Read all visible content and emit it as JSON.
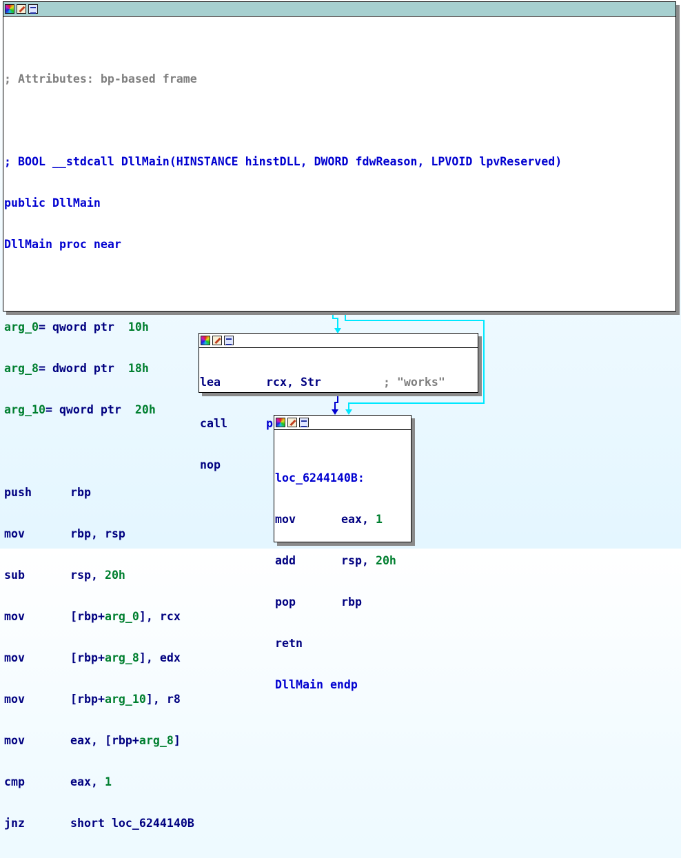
{
  "colors": {
    "keyword_blue": "#0000d0",
    "navy": "#000080",
    "number_green": "#007f2f",
    "comment_gray": "#7f7f7f",
    "main_titlebar": "#a7d0d0",
    "edge_cyan": "#00e8ff",
    "edge_blue": "#0000d0"
  },
  "titlebar_icons": [
    "graph-color-icon",
    "edit-node-icon",
    "text-view-icon"
  ],
  "main_block": {
    "comment": "; Attributes: bp-based frame",
    "prototype": "; BOOL __stdcall DllMain(HINSTANCE hinstDLL, DWORD fdwReason, LPVOID lpvReserved)",
    "public_kw": "public",
    "public_name": "DllMain",
    "proc_name": "DllMain",
    "proc_rest": "proc near",
    "args": [
      {
        "name": "arg_0",
        "eq": "=",
        "type": " qword ptr  ",
        "offset": "10h"
      },
      {
        "name": "arg_8",
        "eq": "=",
        "type": " dword ptr  ",
        "offset": "18h"
      },
      {
        "name": "arg_10",
        "eq": "=",
        "type": " qword ptr  ",
        "offset": "20h"
      }
    ],
    "ins": {
      "push": "push",
      "push_op": "rbp",
      "mov1": "mov",
      "mov1_op": "rbp, rsp",
      "sub": "sub",
      "sub_op1": "rsp, ",
      "sub_op2": "20h",
      "mov2": "mov",
      "mov2_a": "[rbp+",
      "mov2_b": "arg_0",
      "mov2_c": "], rcx",
      "mov3": "mov",
      "mov3_a": "[rbp+",
      "mov3_b": "arg_8",
      "mov3_c": "], edx",
      "mov4": "mov",
      "mov4_a": "[rbp+",
      "mov4_b": "arg_10",
      "mov4_c": "], r8",
      "mov5": "mov",
      "mov5_a": "eax, [rbp+",
      "mov5_b": "arg_8",
      "mov5_c": "]",
      "cmp": "cmp",
      "cmp_a": "eax, ",
      "cmp_b": "1",
      "jnz": "jnz",
      "jnz_op": "short loc_6244140B"
    }
  },
  "call_block": {
    "lea": "lea",
    "lea_op": "rcx, Str",
    "lea_comment": "; \"works\"",
    "call": "call",
    "call_op": "puts",
    "nop": "nop"
  },
  "ret_block": {
    "label": "loc_6244140B:",
    "mov": "mov",
    "mov_a": "eax, ",
    "mov_b": "1",
    "add": "add",
    "add_a": "rsp, ",
    "add_b": "20h",
    "pop": "pop",
    "pop_op": "rbp",
    "retn": "retn",
    "endp_name": "DllMain",
    "endp": "endp"
  }
}
